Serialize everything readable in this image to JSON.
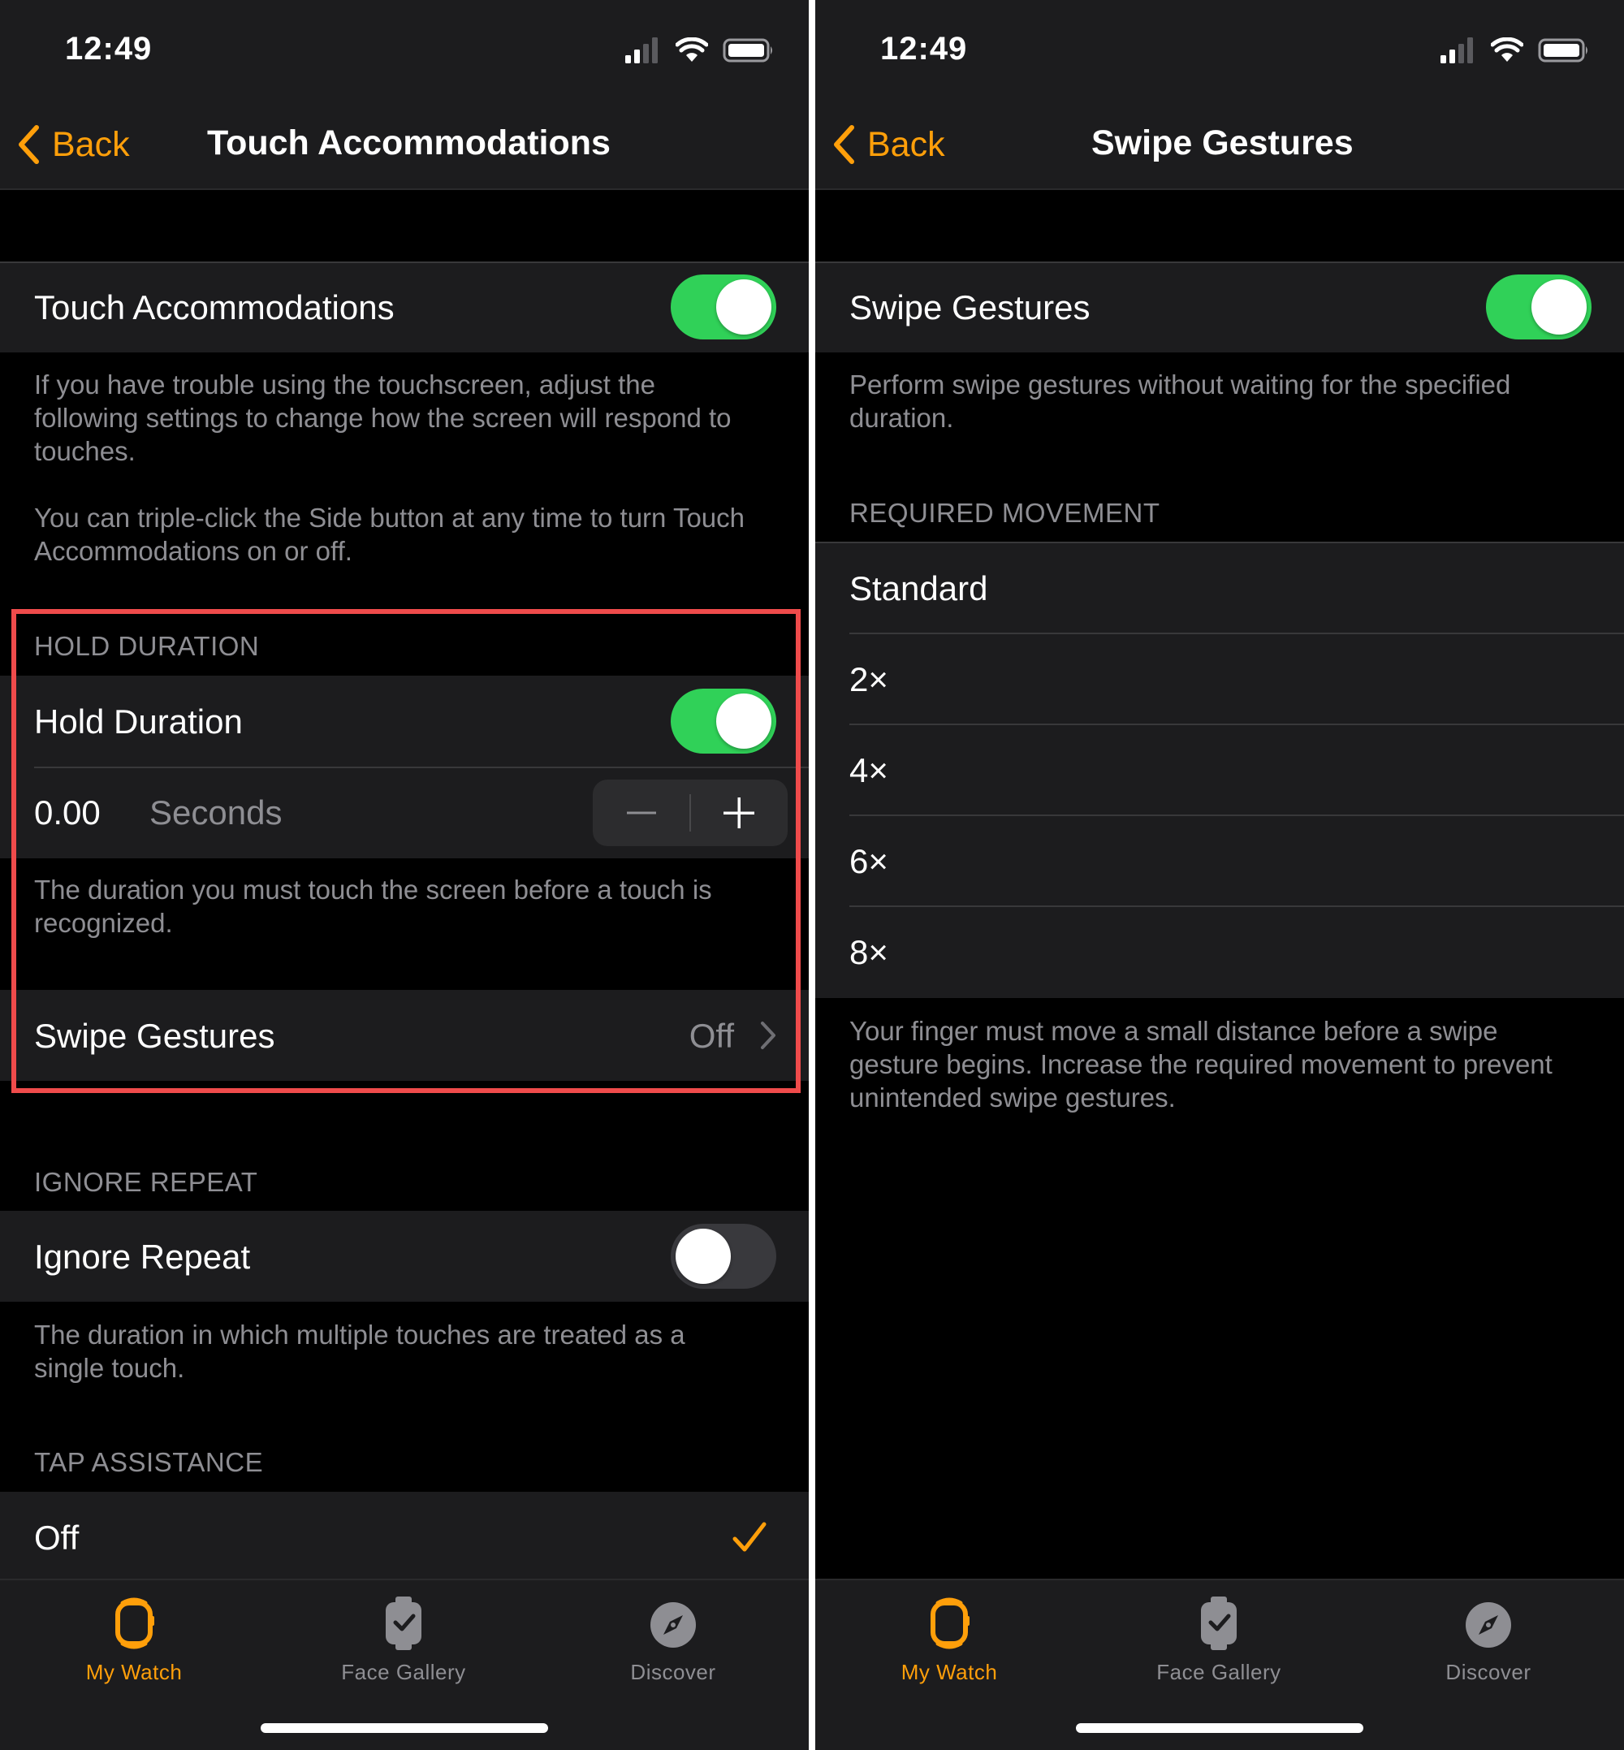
{
  "colors": {
    "accent": "#ff9f0a",
    "toggle_on": "#30d158",
    "highlight": "#ef4b4b",
    "background": "#000000",
    "cell_background": "#1c1c1e",
    "secondary_text": "#8e8e93"
  },
  "status_bar": {
    "time": "12:49",
    "icons": [
      "cellular-signal-icon",
      "wifi-icon",
      "battery-icon"
    ]
  },
  "left_screen": {
    "nav": {
      "back_label": "Back",
      "title": "Touch Accommodations"
    },
    "touch_accommodations": {
      "label": "Touch Accommodations",
      "enabled": true,
      "footer_1": "If you have trouble using the touchscreen, adjust the following settings to change how the screen will respond to touches.",
      "footer_2": "You can triple-click the Side button at any time to turn Touch Accommodations on or off."
    },
    "hold_duration": {
      "header": "HOLD DURATION",
      "label": "Hold Duration",
      "enabled": true,
      "value": "0.00",
      "unit": "Seconds",
      "decrement_symbol": "minus-icon",
      "increment_symbol": "plus-icon",
      "footer": "The duration you must touch the screen before a touch is recognized."
    },
    "swipe_gestures": {
      "label": "Swipe Gestures",
      "value": "Off"
    },
    "ignore_repeat": {
      "header": "IGNORE REPEAT",
      "label": "Ignore Repeat",
      "enabled": false,
      "footer": "The duration in which multiple touches are treated as a single touch."
    },
    "tap_assistance": {
      "header": "TAP ASSISTANCE",
      "selected_option": "Off"
    }
  },
  "right_screen": {
    "nav": {
      "back_label": "Back",
      "title": "Swipe Gestures"
    },
    "swipe_gestures": {
      "label": "Swipe Gestures",
      "enabled": true,
      "footer": "Perform swipe gestures without waiting for the specified duration."
    },
    "required_movement": {
      "header": "REQUIRED MOVEMENT",
      "options": [
        "Standard",
        "2×",
        "4×",
        "6×",
        "8×"
      ],
      "footer": "Your finger must move a small distance before a swipe gesture begins. Increase the required movement to prevent unintended swipe gestures."
    }
  },
  "tab_bar": {
    "tabs": [
      {
        "label": "My Watch",
        "icon": "watch-icon",
        "active": true
      },
      {
        "label": "Face Gallery",
        "icon": "face-gallery-icon",
        "active": false
      },
      {
        "label": "Discover",
        "icon": "compass-icon",
        "active": false
      }
    ]
  }
}
